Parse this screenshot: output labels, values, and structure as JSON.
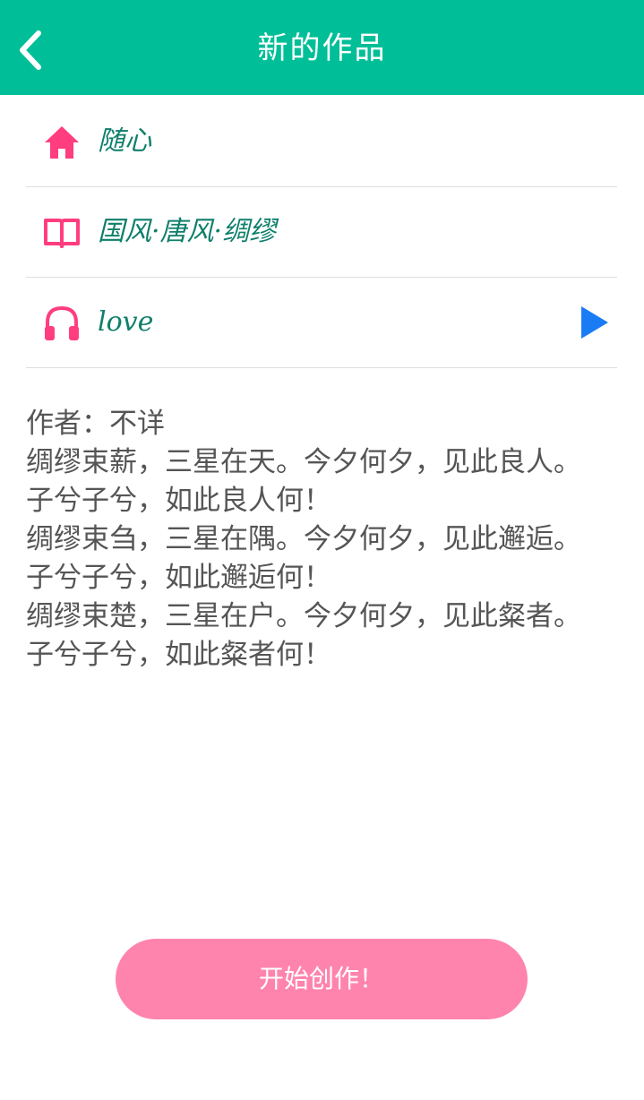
{
  "header": {
    "title": "新的作品",
    "back_icon": "chevron-left-icon",
    "bg_color": "#00bf98"
  },
  "rows": [
    {
      "icon": "home-icon",
      "text": "随心"
    },
    {
      "icon": "book-icon",
      "text": "国风·唐风·绸缪"
    },
    {
      "icon": "headphones-icon",
      "text": "love",
      "action_icon": "play-icon"
    }
  ],
  "poem": {
    "author_line": "作者：不详",
    "lines": [
      "绸缪束薪，三星在天。今夕何夕，见此良人。",
      "子兮子兮，如此良人何！",
      "绸缪束刍，三星在隅。今夕何夕，见此邂逅。",
      "子兮子兮，如此邂逅何！",
      "绸缪束楚，三星在户。今夕何夕，见此粲者。",
      "子兮子兮，如此粲者何！"
    ]
  },
  "start_button": {
    "label": "开始创作！",
    "color": "#ff84ad"
  },
  "colors": {
    "icon_pink": "#ff3d7f",
    "row_text": "#0f7f6b",
    "play_blue": "#1a7cf5"
  }
}
